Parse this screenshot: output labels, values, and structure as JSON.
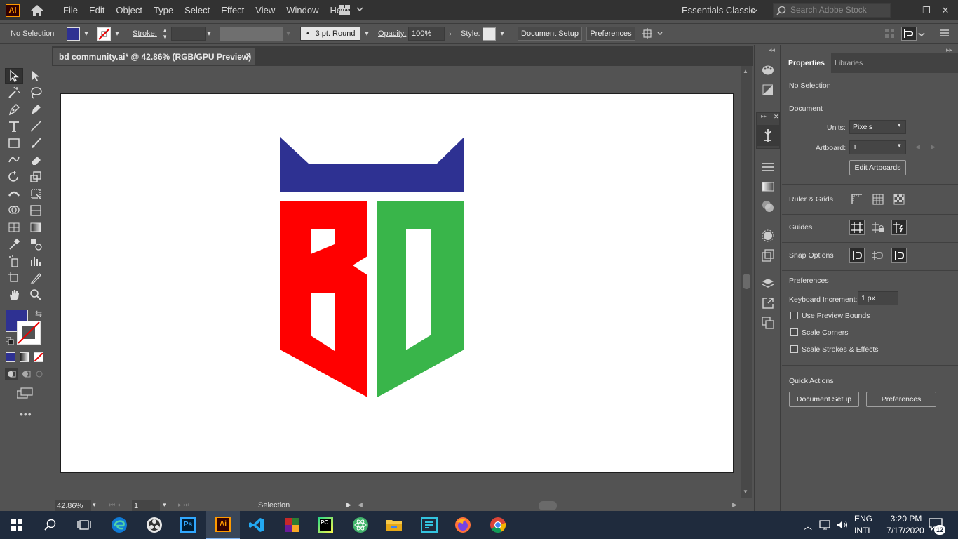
{
  "menubar": {
    "app_badge": "Ai",
    "items": [
      "File",
      "Edit",
      "Object",
      "Type",
      "Select",
      "Effect",
      "View",
      "Window",
      "Help"
    ],
    "workspace": "Essentials Classic",
    "search_placeholder": "Search Adobe Stock"
  },
  "controlbar": {
    "selection_label": "No Selection",
    "stroke_label": "Stroke:",
    "brush_profile": "3 pt. Round",
    "opacity_label": "Opacity:",
    "opacity_value": "100%",
    "style_label": "Style:",
    "document_setup": "Document Setup",
    "preferences": "Preferences",
    "fill_color": "#2e3192"
  },
  "document": {
    "tab_title": "bd community.ai* @ 42.86% (RGB/GPU Preview)",
    "close_glyph": "✕"
  },
  "artwork": {
    "blue": "#2e3192",
    "red": "#ff0000",
    "green": "#39b54a"
  },
  "statusbar": {
    "zoom": "42.86%",
    "artboard": "1",
    "tool": "Selection"
  },
  "properties": {
    "tab_properties": "Properties",
    "tab_libraries": "Libraries",
    "selection": "No Selection",
    "document_header": "Document",
    "units_label": "Units:",
    "units_value": "Pixels",
    "artboard_label": "Artboard:",
    "artboard_value": "1",
    "edit_artboards": "Edit Artboards",
    "ruler_grids": "Ruler & Grids",
    "guides": "Guides",
    "snap_options": "Snap Options",
    "preferences_header": "Preferences",
    "keyboard_increment_label": "Keyboard Increment:",
    "keyboard_increment_value": "1 px",
    "use_preview_bounds": "Use Preview Bounds",
    "scale_corners": "Scale Corners",
    "scale_strokes": "Scale Strokes & Effects",
    "quick_actions": "Quick Actions",
    "qa_document_setup": "Document Setup",
    "qa_preferences": "Preferences"
  },
  "taskbar": {
    "lang_top": "ENG",
    "lang_bottom": "INTL",
    "time": "3:20 PM",
    "date": "7/17/2020",
    "notifications": "12",
    "apps": [
      "start-icon",
      "search-icon",
      "task-view-icon",
      "edge-icon",
      "obs-icon",
      "photoshop-icon",
      "illustrator-icon",
      "vscode-icon",
      "winrar-icon",
      "pycharm-icon",
      "atom-icon",
      "file-explorer-icon",
      "code-editor-icon",
      "firefox-icon",
      "chrome-icon"
    ]
  }
}
